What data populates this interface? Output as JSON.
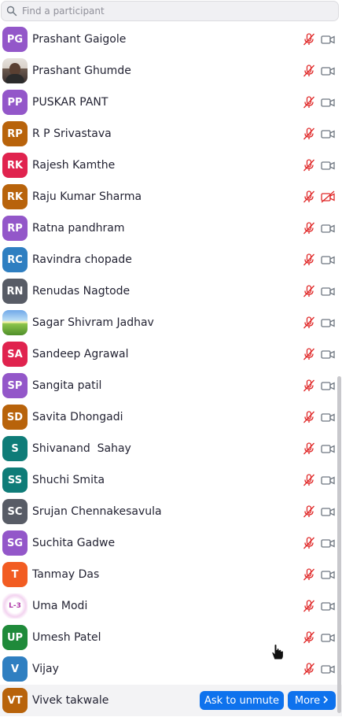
{
  "search": {
    "placeholder": "Find a participant"
  },
  "participants": [
    {
      "initials": "PG",
      "name": "Prashant Gaigole",
      "avatar_color": "#9357c9",
      "avatar_type": "initials",
      "video_off": false
    },
    {
      "initials": "",
      "name": "Prashant Ghumde",
      "avatar_color": "#d9d2ca",
      "avatar_type": "photo-man",
      "video_off": false
    },
    {
      "initials": "PP",
      "name": "PUSKAR PANT",
      "avatar_color": "#9357c9",
      "avatar_type": "initials",
      "video_off": false
    },
    {
      "initials": "RP",
      "name": "R P Srivastava",
      "avatar_color": "#b8630b",
      "avatar_type": "initials",
      "video_off": false
    },
    {
      "initials": "RK",
      "name": "Rajesh Kamthe",
      "avatar_color": "#e0234e",
      "avatar_type": "initials",
      "video_off": false
    },
    {
      "initials": "RK",
      "name": "Raju Kumar Sharma",
      "avatar_color": "#b8630b",
      "avatar_type": "initials",
      "video_off": true
    },
    {
      "initials": "RP",
      "name": "Ratna pandhram",
      "avatar_color": "#9357c9",
      "avatar_type": "initials",
      "video_off": false
    },
    {
      "initials": "RC",
      "name": "Ravindra chopade",
      "avatar_color": "#2f7fc1",
      "avatar_type": "initials",
      "video_off": false
    },
    {
      "initials": "RN",
      "name": "Renudas Nagtode",
      "avatar_color": "#585c66",
      "avatar_type": "initials",
      "video_off": false
    },
    {
      "initials": "",
      "name": "Sagar Shivram Jadhav",
      "avatar_color": "#8bc34a",
      "avatar_type": "photo-field",
      "video_off": false
    },
    {
      "initials": "SA",
      "name": "Sandeep Agrawal",
      "avatar_color": "#e0234e",
      "avatar_type": "initials",
      "video_off": false
    },
    {
      "initials": "SP",
      "name": "Sangita patil",
      "avatar_color": "#9357c9",
      "avatar_type": "initials",
      "video_off": false
    },
    {
      "initials": "SD",
      "name": "Savita Dhongadi",
      "avatar_color": "#b8630b",
      "avatar_type": "initials",
      "video_off": false
    },
    {
      "initials": "S",
      "name": "Shivanand  Sahay",
      "avatar_color": "#0f7c78",
      "avatar_type": "initials",
      "video_off": false
    },
    {
      "initials": "SS",
      "name": "Shuchi Smita",
      "avatar_color": "#0f7c78",
      "avatar_type": "initials",
      "video_off": false
    },
    {
      "initials": "SC",
      "name": "Srujan Chennakesavula",
      "avatar_color": "#585c66",
      "avatar_type": "initials",
      "video_off": false
    },
    {
      "initials": "SG",
      "name": "Suchita Gadwe",
      "avatar_color": "#9357c9",
      "avatar_type": "initials",
      "video_off": false
    },
    {
      "initials": "T",
      "name": "Tanmay Das",
      "avatar_color": "#f25c22",
      "avatar_type": "initials",
      "video_off": false
    },
    {
      "initials": "L-3",
      "name": "Uma Modi",
      "avatar_color": "#ffffff",
      "avatar_type": "logo-l3",
      "video_off": false
    },
    {
      "initials": "UP",
      "name": "Umesh Patel",
      "avatar_color": "#1f8a3a",
      "avatar_type": "initials",
      "video_off": false
    },
    {
      "initials": "V",
      "name": "Vijay",
      "avatar_color": "#2f7fc1",
      "avatar_type": "initials",
      "video_off": false
    },
    {
      "initials": "VT",
      "name": "Vivek takwale",
      "avatar_color": "#b8630b",
      "avatar_type": "initials",
      "video_off": false,
      "hovered": true
    }
  ],
  "hover_actions": {
    "ask_to_unmute_label": "Ask to unmute",
    "more_label": "More"
  },
  "colors": {
    "muted_red": "#e02828",
    "video_gray": "#6e7680",
    "accent_blue": "#0e72ed"
  },
  "icons": {
    "search": "search-icon",
    "mic_muted": "mic-muted-icon",
    "video_on": "video-icon",
    "video_off": "video-off-icon",
    "chevron": "chevron-right-icon"
  }
}
